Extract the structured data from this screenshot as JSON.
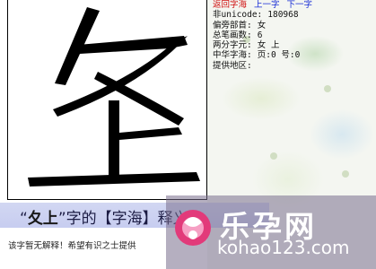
{
  "glyph": {
    "character": "𡈨",
    "radicals": "夂上"
  },
  "info": {
    "nav": {
      "back": "返回字海",
      "prev": "上一字",
      "next": "下一字"
    },
    "rows": [
      {
        "label": "非unicode:",
        "value": "180968"
      },
      {
        "label": "偏旁部首:",
        "value": "女"
      },
      {
        "label": "总笔画数:",
        "value": "6"
      },
      {
        "label": "两分字元:",
        "value": "女 上"
      },
      {
        "label": "中华字海:",
        "value": "页:0 号:0"
      },
      {
        "label": "提供地区:",
        "value": ""
      }
    ]
  },
  "title": {
    "open_quote": "“",
    "char": "夂上",
    "close_quote": "”",
    "suffix": "字的【字海】释义"
  },
  "note": "该字暂无解释！希望有识之士提供",
  "watermark": {
    "name": "乐孕网",
    "url": "kohao123.com"
  },
  "colors": {
    "link": "#1a2fd6",
    "link_active": "#d01010",
    "title_bar": "#c9cff0"
  }
}
